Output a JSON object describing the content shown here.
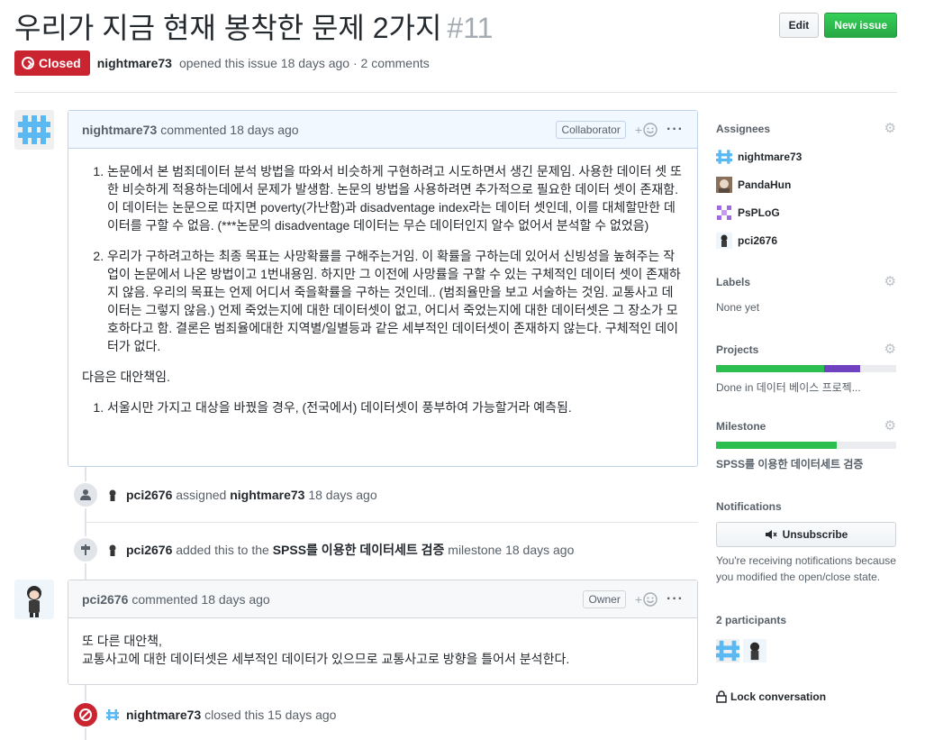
{
  "issue": {
    "title": "우리가 지금 현재 봉착한 문제 2가지",
    "number": "#11",
    "state_label": "Closed",
    "author": "nightmare73",
    "opened_text": "opened this issue 18 days ago · 2 comments"
  },
  "header": {
    "edit_label": "Edit",
    "new_issue_label": "New issue"
  },
  "comment1": {
    "author": "nightmare73",
    "meta": "commented 18 days ago",
    "badge": "Collaborator",
    "items": [
      "논문에서 본 범죄데이터 분석 방법을 따와서 비슷하게 구현하려고 시도하면서 생긴 문제임. 사용한 데이터 셋 또한 비슷하게 적용하는데에서 문제가 발생함. 논문의 방법을 사용하려면 추가적으로 필요한 데이터 셋이 존재함. 이 데이터는 논문으로 따지면 poverty(가난함)과 disadventage index라는 데이터 셋인데, 이를 대체할만한 데이터를 구할 수 없음. (***논문의 disadventage 데이터는 무슨 데이터인지 알수 없어서 분석할 수 없었음)",
      "우리가 구하려고하는 최종 목표는 사망확률를 구해주는거임. 이 확률을 구하는데 있어서 신빙성을 높혀주는 작업이 논문에서 나온 방법이고 1번내용임. 하지만 그 이전에 사망률을 구할 수 있는 구체적인 데이터 셋이 존재하지 않음. 우리의 목표는 언제 어디서 죽을확률을 구하는 것인데.. (범죄율만을 보고 서술하는 것임. 교통사고 데이터는 그렇지 않음.) 언제 죽었는지에 대한 데이터셋이 없고, 어디서 죽었는지에 대한 데이터셋은 그 장소가 모호하다고 함. 결론은 범죄율에대한 지역별/일별등과 같은 세부적인 데이터셋이 존재하지 않는다. 구체적인 데이터가 없다."
    ],
    "para": "다음은 대안책임.",
    "items2": [
      "서울시만 가지고 대상을 바꿨을 경우, (전국에서) 데이터셋이 풍부하여 가능할거라 예측됨."
    ]
  },
  "event1": {
    "actor": "pci2676",
    "action": "assigned",
    "target": "nightmare73",
    "time": "18 days ago"
  },
  "event2": {
    "actor": "pci2676",
    "action": "added this to the",
    "target": "SPSS를 이용한 데이터세트 검증",
    "suffix": "milestone 18 days ago"
  },
  "comment2": {
    "author": "pci2676",
    "meta": "commented 18 days ago",
    "badge": "Owner",
    "line1": "또 다른 대안책,",
    "line2": "교통사고에 대한 데이터셋은 세부적인 데이터가 있으므로 교통사고로 방향을 틀어서 분석한다."
  },
  "event3": {
    "actor": "nightmare73",
    "action": "closed this 15 days ago"
  },
  "sidebar": {
    "assignees_label": "Assignees",
    "assignees": [
      "nightmare73",
      "PandaHun",
      "PsPLoG",
      "pci2676"
    ],
    "labels_label": "Labels",
    "labels_value": "None yet",
    "projects_label": "Projects",
    "projects_value": "Done in 데이터 베이스 프로젝...",
    "project_progress": {
      "done": 0.6,
      "in_progress": 0.2
    },
    "milestone_label": "Milestone",
    "milestone_value": "SPSS를 이용한 데이터세트 검증",
    "milestone_progress": 0.67,
    "notifications_label": "Notifications",
    "unsubscribe_label": "Unsubscribe",
    "notifications_note": "You're receiving notifications because you modified the open/close state.",
    "participants_label": "2 participants",
    "lock_label": "Lock conversation"
  },
  "colors": {
    "closed": "#cb2431",
    "green": "#2cbe4e",
    "purple": "#6f42c1",
    "identicon": "#5ab8f2"
  }
}
